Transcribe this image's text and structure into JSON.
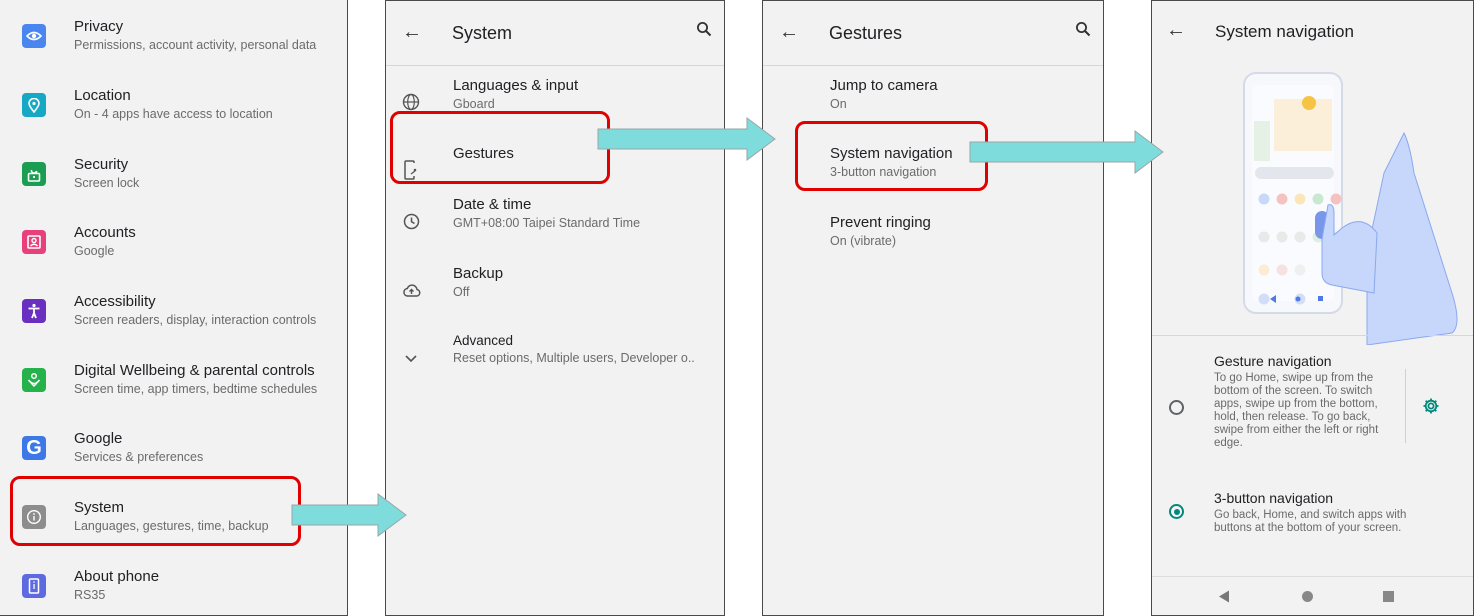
{
  "panel1": {
    "items": [
      {
        "title": "Privacy",
        "subtitle": "Permissions, account activity, personal data",
        "icon": "privacy-icon",
        "color": "#4a86f0"
      },
      {
        "title": "Location",
        "subtitle": "On - 4 apps have access to location",
        "icon": "location-icon",
        "color": "#17a8c6"
      },
      {
        "title": "Security",
        "subtitle": "Screen lock",
        "icon": "lock-icon",
        "color": "#1b9e51"
      },
      {
        "title": "Accounts",
        "subtitle": "Google",
        "icon": "accounts-icon",
        "color": "#e8407a"
      },
      {
        "title": "Accessibility",
        "subtitle": "Screen readers, display, interaction controls",
        "icon": "accessibility-icon",
        "color": "#6a2fc1"
      },
      {
        "title": "Digital Wellbeing & parental controls",
        "subtitle": "Screen time, app timers, bedtime schedules",
        "icon": "wellbeing-icon",
        "color": "#25b24a"
      },
      {
        "title": "Google",
        "subtitle": "Services & preferences",
        "icon": "google-icon",
        "color": "#3c78e8"
      },
      {
        "title": "System",
        "subtitle": "Languages, gestures, time, backup",
        "icon": "info-icon",
        "color": "#8d8d8d"
      },
      {
        "title": "About phone",
        "subtitle": "RS35",
        "icon": "phone-icon",
        "color": "#5e6be0"
      }
    ]
  },
  "panel2": {
    "title": "System",
    "items": [
      {
        "title": "Languages & input",
        "subtitle": "Gboard",
        "icon": "globe-icon"
      },
      {
        "title": "Gestures",
        "subtitle": "",
        "icon": "gestures-icon"
      },
      {
        "title": "Date & time",
        "subtitle": "GMT+08:00 Taipei Standard Time",
        "icon": "clock-icon"
      },
      {
        "title": "Backup",
        "subtitle": "Off",
        "icon": "cloud-upload-icon"
      },
      {
        "title": "Advanced",
        "subtitle": "Reset options, Multiple users, Developer o..",
        "icon": "chevron-down-icon"
      }
    ]
  },
  "panel3": {
    "title": "Gestures",
    "items": [
      {
        "title": "Jump to camera",
        "subtitle": "On"
      },
      {
        "title": "System navigation",
        "subtitle": "3-button navigation"
      },
      {
        "title": "Prevent ringing",
        "subtitle": "On (vibrate)"
      }
    ]
  },
  "panel4": {
    "title": "System navigation",
    "options": [
      {
        "title": "Gesture navigation",
        "description_lines": [
          "To go Home, swipe up from the",
          "bottom of the screen. To switch",
          "apps, swipe up from the bottom,",
          "hold, then release. To go back,",
          "swipe from either the left or right",
          "edge."
        ],
        "selected": false
      },
      {
        "title": "3-button navigation",
        "description_lines": [
          "Go back, Home, and switch apps with",
          "buttons at the bottom of your screen."
        ],
        "selected": true
      }
    ]
  },
  "colors": {
    "highlight": "#e00000",
    "arrow": "#7fdcdc",
    "accent": "#00897b"
  }
}
